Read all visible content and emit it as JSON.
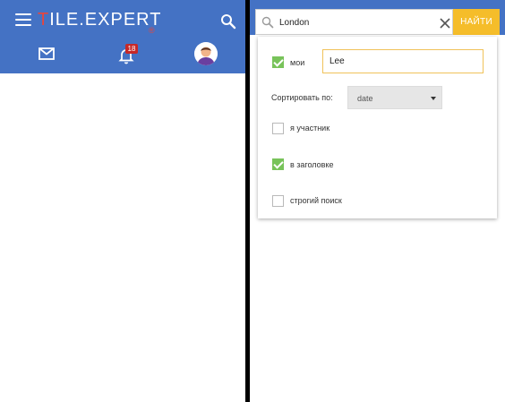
{
  "left": {
    "logo": {
      "prefix": "T",
      "rest": "ILE.EXPERT",
      "dot": "®"
    },
    "notifications_count": "18"
  },
  "search": {
    "query": "London",
    "button_label": "НАЙТИ"
  },
  "filters": {
    "mine": {
      "label": "мои",
      "checked": true,
      "name_value": "Lee"
    },
    "sort": {
      "label": "Сортировать по:",
      "value": "date"
    },
    "participant": {
      "label": "я участник",
      "checked": false
    },
    "in_title": {
      "label": "в заголовке",
      "checked": true
    },
    "strict": {
      "label": "строгий поиск",
      "checked": false
    }
  },
  "colors": {
    "header_blue": "#4472c4",
    "accent_yellow": "#f5bd2a",
    "check_green": "#78c35a",
    "logo_red": "#e8453c",
    "badge_red": "#c62828"
  },
  "icons": [
    "menu-icon",
    "search-icon",
    "mail-icon",
    "bell-icon",
    "avatar-icon",
    "close-icon",
    "chevron-down-icon"
  ]
}
